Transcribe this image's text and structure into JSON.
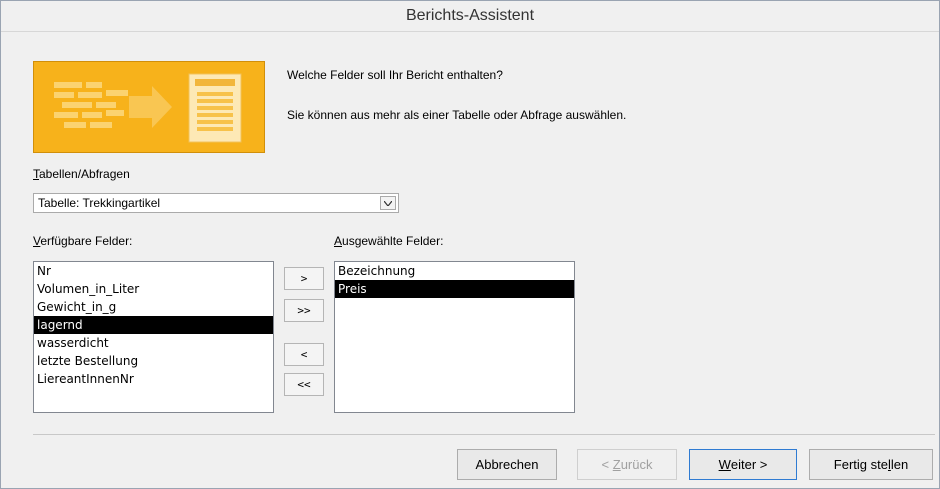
{
  "window": {
    "title": "Berichts-Assistent"
  },
  "intro": {
    "question": "Welche Felder soll Ihr Bericht enthalten?",
    "hint": "Sie können aus mehr als einer Tabelle oder Abfrage auswählen."
  },
  "source": {
    "label_accel": "T",
    "label_rest": "abellen/Abfragen",
    "selected": "Tabelle: Trekkingartikel"
  },
  "available": {
    "label_accel": "V",
    "label_rest": "erfügbare Felder:",
    "items": [
      "Nr",
      "Volumen_in_Liter",
      "Gewicht_in_g",
      "lagernd",
      "wasserdicht",
      "letzte Bestellung",
      "LiereantInnenNr"
    ],
    "selected_index": 3
  },
  "selected_fields": {
    "label_accel": "A",
    "label_rest": "usgewählte Felder:",
    "items": [
      "Bezeichnung",
      "Preis"
    ],
    "selected_index": 1
  },
  "move_buttons": {
    "add_one": ">",
    "add_all": ">>",
    "remove_one": "<",
    "remove_all": "<<"
  },
  "footer": {
    "cancel": "Abbrechen",
    "back_prefix": "< ",
    "back_accel": "Z",
    "back_rest": "urück",
    "next_accel": "W",
    "next_rest": "eiter >",
    "finish_prefix": "Fertig ste",
    "finish_accel": "l",
    "finish_rest": "len"
  },
  "colors": {
    "graphic": "#f7b21b",
    "selection": "#000000"
  }
}
